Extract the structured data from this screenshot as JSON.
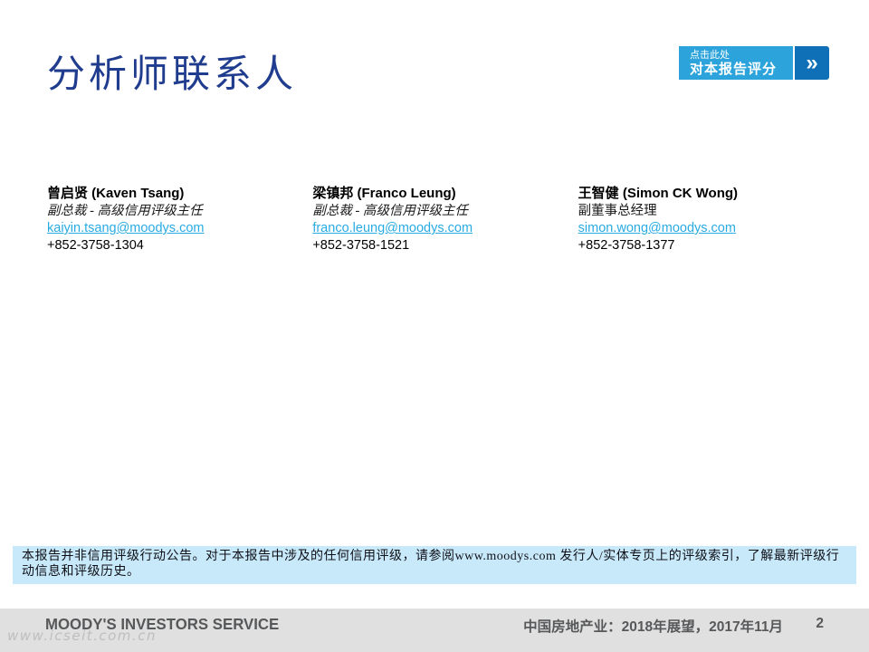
{
  "slide": {
    "title": "分析师联系人",
    "rate_button": {
      "line1": "点击此处",
      "line2": "对本报告评分",
      "chevron": "»"
    },
    "analysts": [
      {
        "name": "曾启贤 (Kaven Tsang)",
        "role": "副总裁 - 高级信用评级主任",
        "email": "kaiyin.tsang@moodys.com",
        "phone": "+852-3758-1304"
      },
      {
        "name": "梁镇邦 (Franco Leung)",
        "role": "副总裁 - 高级信用评级主任",
        "email": "franco.leung@moodys.com",
        "phone": "+852-3758-1521"
      },
      {
        "name": "王智健 (Simon CK Wong)",
        "role": "副董事总经理",
        "email": "simon.wong@moodys.com",
        "phone": "+852-3758-1377"
      }
    ],
    "disclaimer": "本报告并非信用评级行动公告。对于本报告中涉及的任何信用评级，请参阅www.moodys.com 发行人/实体专页上的评级索引，了解最新评级行动信息和评级历史。",
    "footer": {
      "brand": "MOODY'S INVESTORS SERVICE",
      "report_title": "中国房地产业：2018年展望，2017年11月",
      "page_number": "2"
    },
    "watermark": "www.icseit.com.cn",
    "colors": {
      "title_blue": "#203c8e",
      "button_light_blue": "#2ca4db",
      "button_dark_blue": "#0f70b8",
      "link_blue": "#29abe2",
      "disclaimer_bg": "#c7e9f9",
      "footer_bg": "#e0e0e0",
      "footer_text": "#57585a"
    }
  }
}
